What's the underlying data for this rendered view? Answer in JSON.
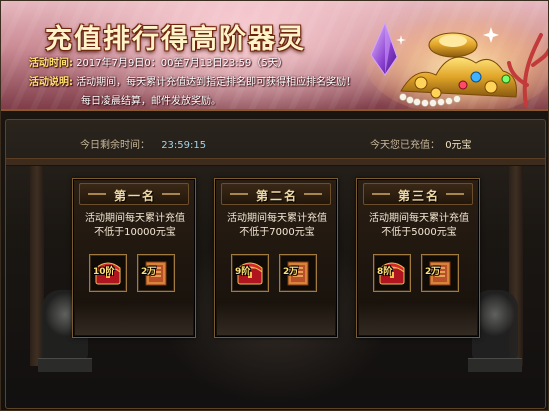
{
  "banner": {
    "title": "充值排行得高阶器灵",
    "time_label": "活动时间:",
    "time_value": "2017年7月9日0：00至7月13日23:59（5天）",
    "desc_label": "活动说明:",
    "desc_line1": "活动期间，每天累计充值达到指定排名即可获得相应排名奖励！",
    "desc_line2": "每日凌晨结算，邮件发放奖励。"
  },
  "status": {
    "remain_label": "今日剩余时间：",
    "remain_value": "23:59:15",
    "recharged_label": "今天您已充值：",
    "recharged_value": "0元宝"
  },
  "ranks": [
    {
      "title": "第一名",
      "desc_line1": "活动期间每天累计充值",
      "desc_line2": "不低于10000元宝",
      "reward1_label": "10阶",
      "reward2_label": "2万"
    },
    {
      "title": "第二名",
      "desc_line1": "活动期间每天累计充值",
      "desc_line2": "不低于7000元宝",
      "reward1_label": "9阶",
      "reward2_label": "2万"
    },
    {
      "title": "第三名",
      "desc_line1": "活动期间每天累计充值",
      "desc_line2": "不低于5000元宝",
      "reward1_label": "8阶",
      "reward2_label": "2万"
    }
  ],
  "icons": {
    "reward1": "red-treasure-chest-icon",
    "reward2": "gold-scroll-icon"
  },
  "colors": {
    "title_text": "#fff3c9",
    "label_yellow": "#ffe36b",
    "timer_value": "#9fd2e6",
    "card_border": "#7a5a30",
    "card_title": "#f1d9a6"
  }
}
